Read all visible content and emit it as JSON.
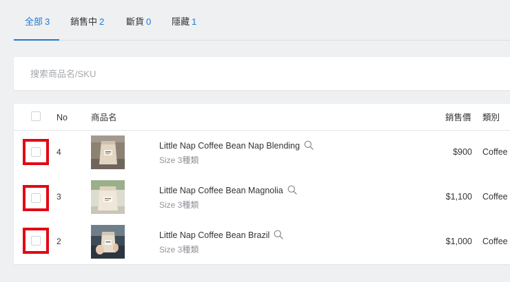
{
  "tabs": [
    {
      "label": "全部",
      "count": "3",
      "active": true
    },
    {
      "label": "銷售中",
      "count": "2",
      "active": false
    },
    {
      "label": "斷貨",
      "count": "0",
      "active": false
    },
    {
      "label": "隱藏",
      "count": "1",
      "active": false
    }
  ],
  "search": {
    "placeholder": "搜索商品名/SKU",
    "value": ""
  },
  "table": {
    "columns": {
      "no": "No",
      "name": "商品名",
      "price": "銷售價",
      "category": "類別"
    },
    "rows": [
      {
        "no": "4",
        "name": "Little Nap Coffee Bean Nap Blending",
        "sub": "Size 3種類",
        "price": "$900",
        "category": "Coffee"
      },
      {
        "no": "3",
        "name": "Little Nap Coffee Bean Magnolia",
        "sub": "Size 3種類",
        "price": "$1,100",
        "category": "Coffee"
      },
      {
        "no": "2",
        "name": "Little Nap Coffee Bean Brazil",
        "sub": "Size 3種類",
        "price": "$1,000",
        "category": "Coffee"
      }
    ]
  },
  "colors": {
    "accent": "#1f78d1",
    "highlight": "#e30613"
  },
  "icons": {
    "row_name_icon": "magnifier-icon"
  }
}
